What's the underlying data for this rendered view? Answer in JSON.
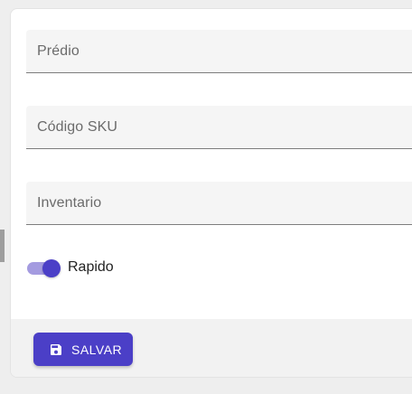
{
  "form": {
    "fields": [
      {
        "label": "Prédio",
        "value": ""
      },
      {
        "label": "Código SKU",
        "value": ""
      },
      {
        "label": "Inventario",
        "value": ""
      }
    ],
    "toggle": {
      "label": "Rapido",
      "on": true
    }
  },
  "footer": {
    "save_label": "SALVAR",
    "save_icon": "save-icon"
  },
  "colors": {
    "accent": "#4b3fc7",
    "accent_light": "#a49be0",
    "field_bg": "#f5f5f5",
    "page_bg": "#eeeeee"
  }
}
